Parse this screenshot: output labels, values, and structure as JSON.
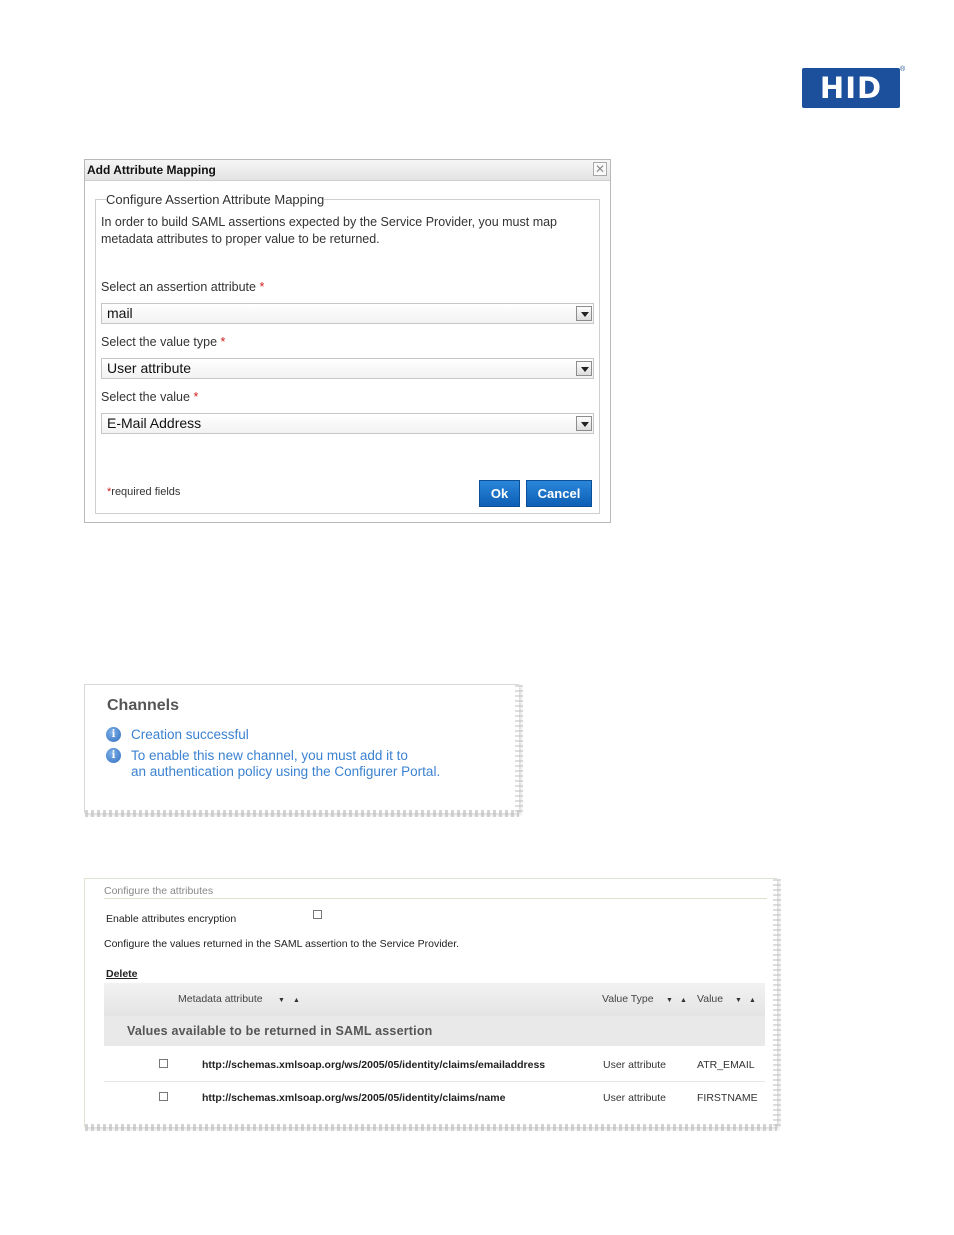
{
  "logo": {
    "text": "HID",
    "mark": "®"
  },
  "dialog": {
    "title": "Add Attribute Mapping",
    "close_symbol": "✕",
    "legend": "Configure Assertion Attribute Mapping",
    "intro": "In order to build SAML assertions expected by the Service Provider, you must map metadata attributes to proper value to be returned.",
    "fields": [
      {
        "label": "Select an assertion attribute",
        "required_mark": "*",
        "value": "mail"
      },
      {
        "label": "Select the value type",
        "required_mark": "*",
        "value": "User attribute"
      },
      {
        "label": "Select the value",
        "required_mark": "*",
        "value": "E-Mail Address"
      }
    ],
    "required_note_mark": "*",
    "required_note": "required fields",
    "ok_label": "Ok",
    "cancel_label": "Cancel"
  },
  "channels": {
    "title": "Channels",
    "messages": [
      {
        "icon": "info-icon",
        "line1": "Creation successful",
        "line2": ""
      },
      {
        "icon": "info-icon",
        "line1": "To enable this new channel, you must add it to",
        "line2": "an authentication policy using the Configurer Portal."
      }
    ]
  },
  "attributes": {
    "legend": "Configure the attributes",
    "encryption_label": "Enable attributes encryption",
    "encryption_checked": false,
    "description": "Configure the values returned in the SAML assertion to the Service Provider.",
    "delete_label": "Delete",
    "columns": [
      "Metadata attribute",
      "Value Type",
      "Value"
    ],
    "group_label": "Values available to be returned in SAML assertion",
    "rows": [
      {
        "url": "http://schemas.xmlsoap.org/ws/2005/05/identity/claims/emailaddress",
        "value_type": "User attribute",
        "value": "ATR_EMAIL"
      },
      {
        "url": "http://schemas.xmlsoap.org/ws/2005/05/identity/claims/name",
        "value_type": "User attribute",
        "value": "FIRSTNAME"
      }
    ]
  }
}
